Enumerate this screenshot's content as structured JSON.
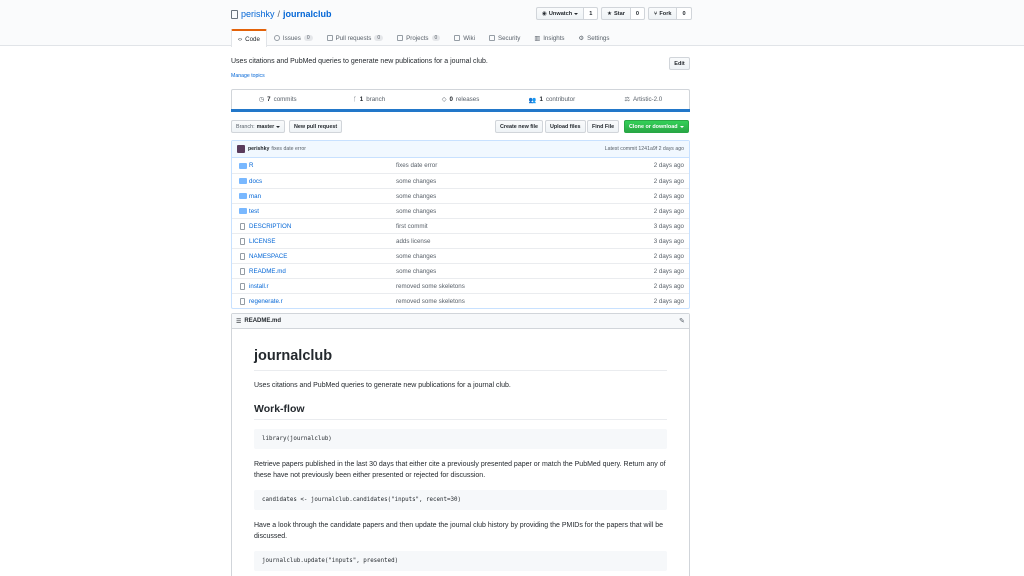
{
  "repo": {
    "owner": "perishky",
    "separator": "/",
    "name": "journalclub"
  },
  "actions": {
    "watch": {
      "label": "Unwatch",
      "count": "1"
    },
    "star": {
      "label": "Star",
      "count": "0"
    },
    "fork": {
      "label": "Fork",
      "count": "0"
    }
  },
  "tabs": [
    {
      "label": "Code",
      "badge": ""
    },
    {
      "label": "Issues",
      "badge": "0"
    },
    {
      "label": "Pull requests",
      "badge": "0"
    },
    {
      "label": "Projects",
      "badge": "0"
    },
    {
      "label": "Wiki",
      "badge": ""
    },
    {
      "label": "Security",
      "badge": ""
    },
    {
      "label": "Insights",
      "badge": ""
    },
    {
      "label": "Settings",
      "badge": ""
    }
  ],
  "description": "Uses citations and PubMed queries to generate new publications for a journal club.",
  "manage_topics": "Manage topics",
  "edit_label": "Edit",
  "summary": {
    "commits": {
      "num": "7",
      "label": "commits"
    },
    "branch": {
      "num": "1",
      "label": "branch"
    },
    "releases": {
      "num": "0",
      "label": "releases"
    },
    "contributor": {
      "num": "1",
      "label": "contributor"
    },
    "license": "Artistic-2.0"
  },
  "lang_color": "#2277c9",
  "branch_bar": {
    "branch_prefix": "Branch:",
    "branch_name": "master",
    "new_pr": "New pull request",
    "create_file": "Create new file",
    "upload": "Upload files",
    "find": "Find File",
    "clone": "Clone or download"
  },
  "latest_commit": {
    "author": "perishky",
    "message": "fixes date error",
    "summary": "Latest commit 1241a9f 2 days ago"
  },
  "files": [
    {
      "type": "dir",
      "name": "R",
      "message": "fixes date error",
      "age": "2 days ago"
    },
    {
      "type": "dir",
      "name": "docs",
      "message": "some changes",
      "age": "2 days ago"
    },
    {
      "type": "dir",
      "name": "man",
      "message": "some changes",
      "age": "2 days ago"
    },
    {
      "type": "dir",
      "name": "test",
      "message": "some changes",
      "age": "2 days ago"
    },
    {
      "type": "file",
      "name": "DESCRIPTION",
      "message": "first commit",
      "age": "3 days ago"
    },
    {
      "type": "file",
      "name": "LICENSE",
      "message": "adds license",
      "age": "3 days ago"
    },
    {
      "type": "file",
      "name": "NAMESPACE",
      "message": "some changes",
      "age": "2 days ago"
    },
    {
      "type": "file",
      "name": "README.md",
      "message": "some changes",
      "age": "2 days ago"
    },
    {
      "type": "file",
      "name": "install.r",
      "message": "removed some skeletons",
      "age": "2 days ago"
    },
    {
      "type": "file",
      "name": "regenerate.r",
      "message": "removed some skeletons",
      "age": "2 days ago"
    }
  ],
  "readme": {
    "filename": "README.md",
    "title": "journalclub",
    "intro": "Uses citations and PubMed queries to generate new publications for a journal club.",
    "h2": "Work-flow",
    "code1": "library(journalclub)",
    "para2": "Retrieve papers published in the last 30 days that either cite a previously presented paper or match the PubMed query. Return any of these have not previously been either presented or rejected for discussion.",
    "code2": "candidates <- journalclub.candidates(\"inputs\", recent=30)",
    "para3": "Have a look through the candidate papers and then update the journal club history by providing the PMIDs for the papers that will be discussed.",
    "code3": "journalclub.update(\"inputs\", presented)"
  }
}
